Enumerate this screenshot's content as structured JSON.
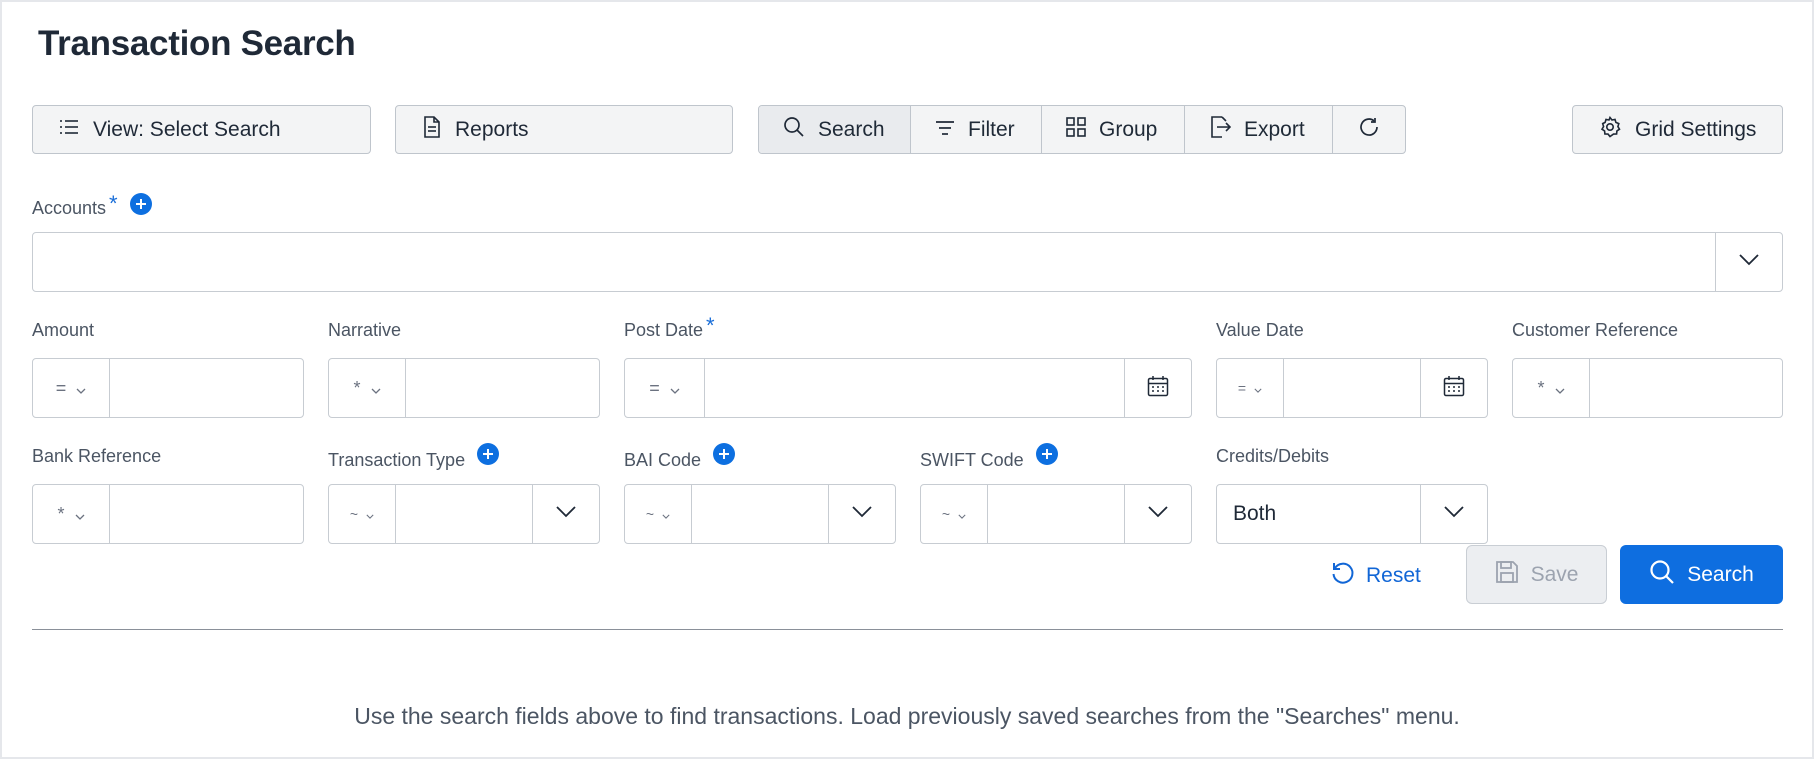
{
  "page": {
    "title": "Transaction Search"
  },
  "toolbar": {
    "view_label": "View: Select Search",
    "reports_label": "Reports",
    "search_label": "Search",
    "filter_label": "Filter",
    "group_label": "Group",
    "export_label": "Export",
    "grid_settings_label": "Grid Settings"
  },
  "fields": {
    "accounts": {
      "label": "Accounts",
      "required_mark": "*",
      "value": ""
    },
    "amount": {
      "label": "Amount",
      "operator": "=",
      "value": ""
    },
    "narrative": {
      "label": "Narrative",
      "operator": "*",
      "value": ""
    },
    "post_date": {
      "label": "Post Date",
      "required_mark": "*",
      "operator": "=",
      "value": ""
    },
    "value_date": {
      "label": "Value Date",
      "operator": "=",
      "value": ""
    },
    "customer_reference": {
      "label": "Customer Reference",
      "operator": "*",
      "value": ""
    },
    "bank_reference": {
      "label": "Bank Reference",
      "operator": "*",
      "value": ""
    },
    "transaction_type": {
      "label": "Transaction Type",
      "operator": "~",
      "value": ""
    },
    "bai_code": {
      "label": "BAI Code",
      "operator": "~",
      "value": ""
    },
    "swift_code": {
      "label": "SWIFT Code",
      "operator": "~",
      "value": ""
    },
    "credits_debits": {
      "label": "Credits/Debits",
      "value": "Both"
    }
  },
  "actions": {
    "reset_label": "Reset",
    "save_label": "Save",
    "search_label": "Search"
  },
  "hint": "Use the search fields above to find transactions. Load previously saved searches from the \"Searches\" menu.",
  "colors": {
    "accent": "#0e6ee0",
    "link": "#1166d6",
    "border": "#c7ccd2",
    "toolbar_bg": "#f3f4f5"
  },
  "icons": {
    "view": "list-icon",
    "reports": "document-icon",
    "search": "search-icon",
    "filter": "filter-icon",
    "group": "grid-icon",
    "export": "export-icon",
    "refresh": "refresh-icon",
    "grid_settings": "gear-icon",
    "calendar": "calendar-icon",
    "chevron": "chevron-down-icon",
    "add": "plus-icon",
    "reset": "reset-icon",
    "save": "save-icon"
  }
}
